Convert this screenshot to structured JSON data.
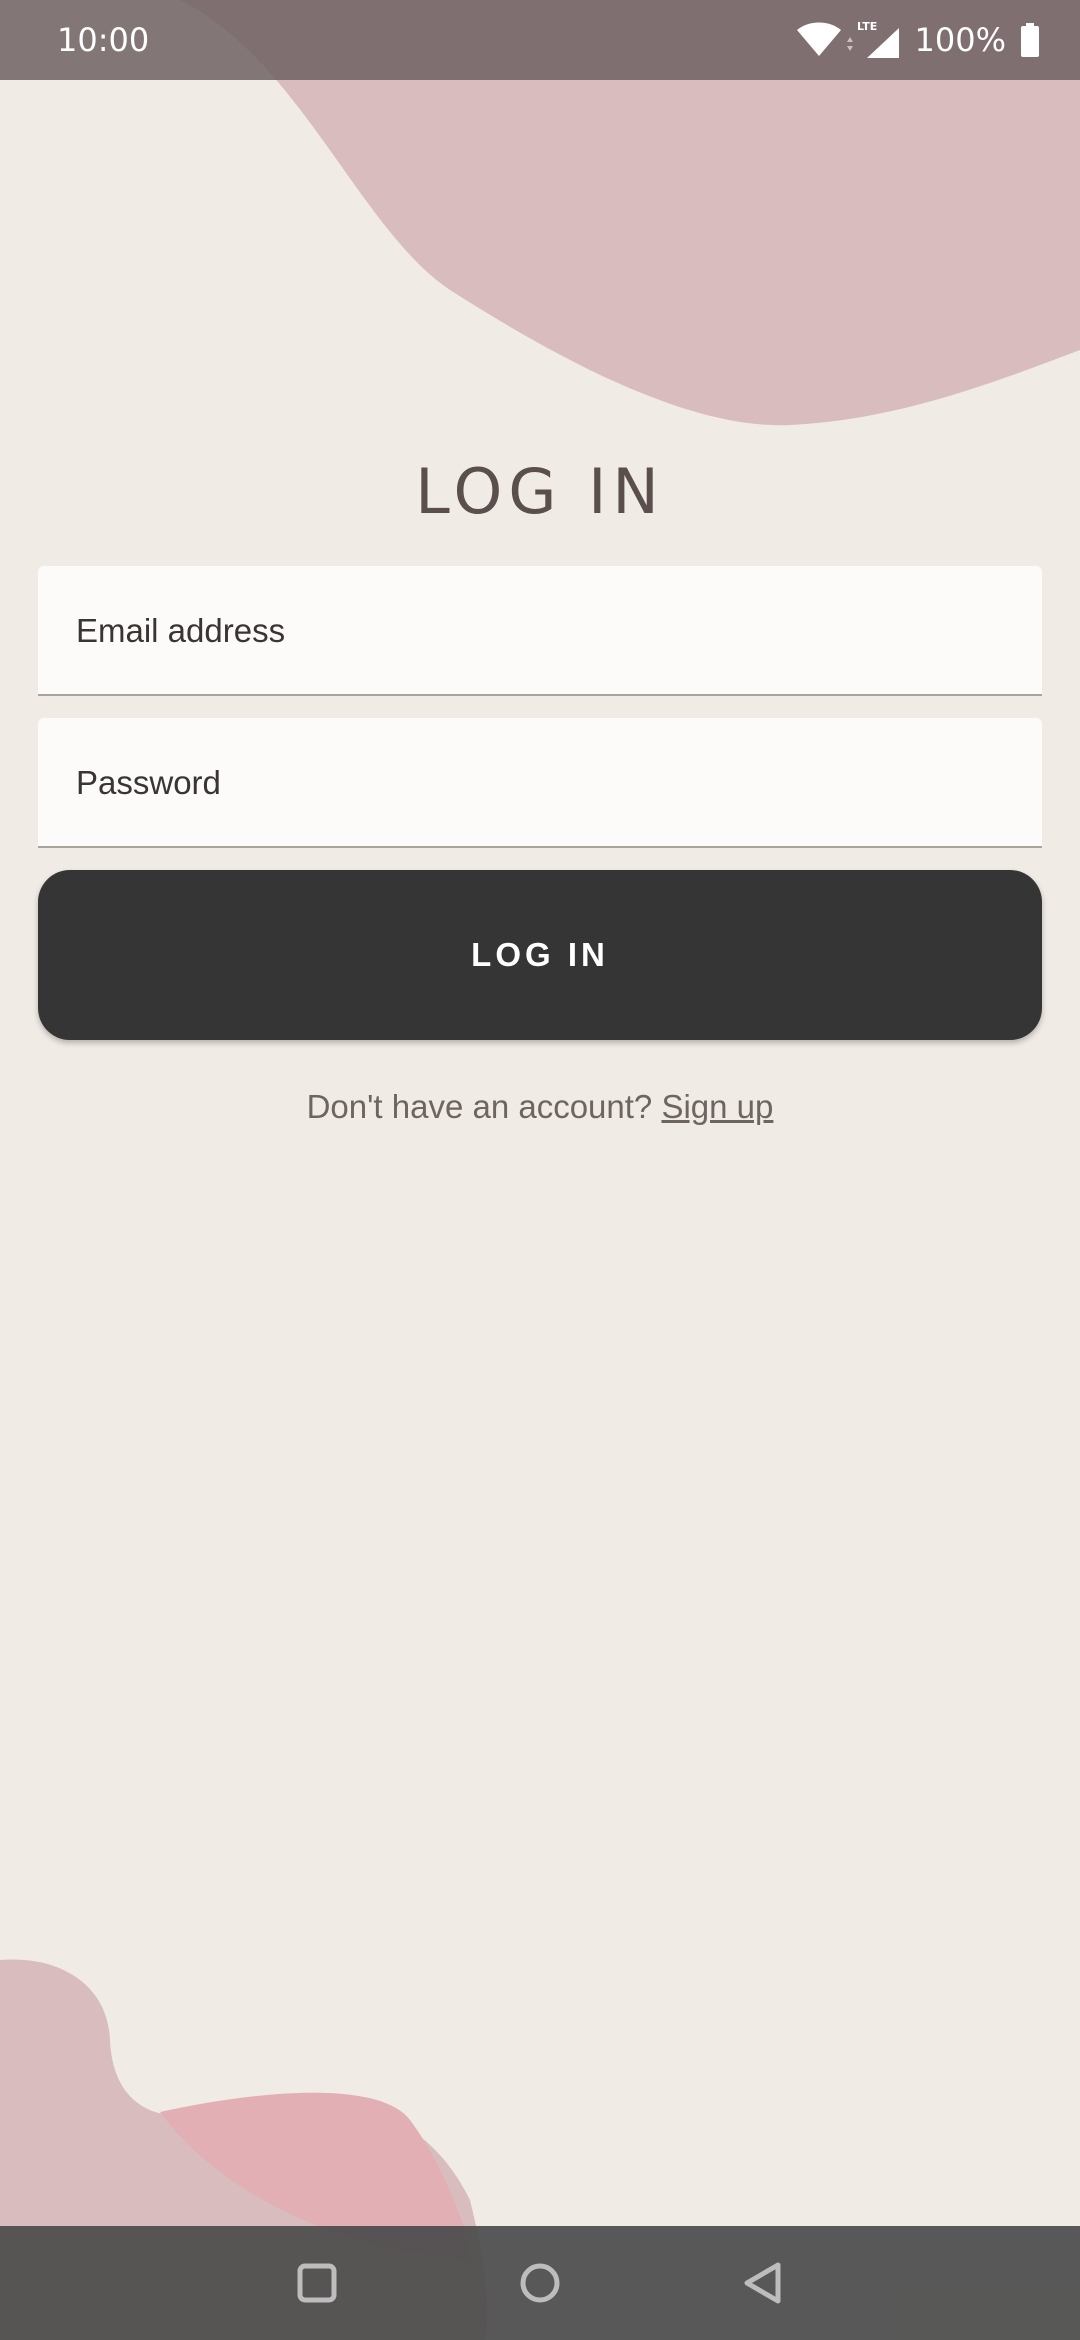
{
  "status_bar": {
    "time": "10:00",
    "network_label": "LTE",
    "battery_percent": "100%"
  },
  "login": {
    "title": "LOG IN",
    "email_placeholder": "Email address",
    "password_placeholder": "Password",
    "button_label": "LOG IN",
    "signup_prompt": "Don't have an account?",
    "signup_link": "Sign up"
  },
  "colors": {
    "background": "#f0ebe5",
    "blob_mauve": "#d9bcbe",
    "blob_pink": "#e2b0b4",
    "button": "#353535",
    "title_text": "#5a4f4d"
  },
  "icons": {
    "status": [
      "wifi-icon",
      "lte-signal-icon",
      "battery-icon"
    ],
    "navigation": [
      "square-recent-apps-icon",
      "circle-home-icon",
      "triangle-back-icon"
    ]
  }
}
